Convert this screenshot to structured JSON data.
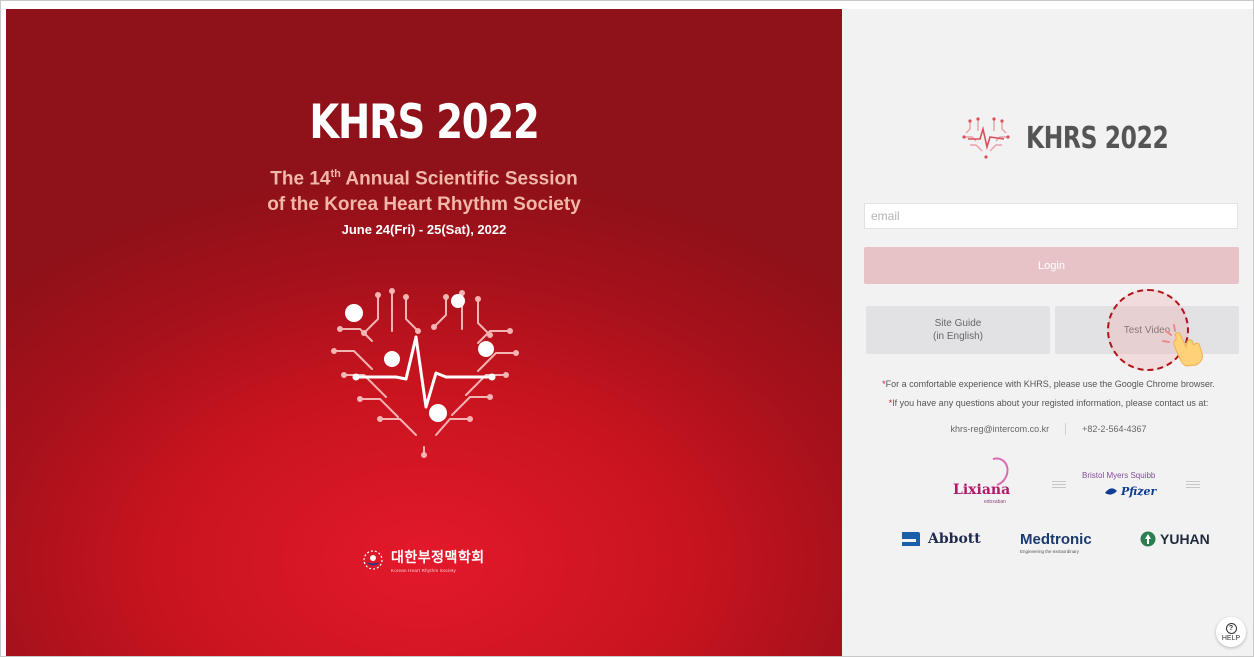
{
  "hero": {
    "title": "KHRS 2022",
    "subtitle_line1_pre": "The 14",
    "subtitle_line1_sup": "th",
    "subtitle_line1_post": " Annual Scientific Session",
    "subtitle_line2": "of the Korea Heart Rhythm Society",
    "date": "June 24(Fri) - 25(Sat), 2022",
    "society_korean": "대한부정맥학회",
    "society_english": "Korean Heart Rhythm Society"
  },
  "panel": {
    "brand": "KHRS 2022",
    "email_placeholder": "email",
    "email_value": "",
    "login_label": "Login",
    "site_guide_line1": "Site Guide",
    "site_guide_line2": "(in English)",
    "test_video_label": "Test Video",
    "note1": "For a comfortable experience with KHRS, please use the Google Chrome browser.",
    "note2": "If you have any questions about your registed information, please contact us at:",
    "note_star": "*",
    "contact_email": "khrs-reg@intercom.co.kr",
    "contact_phone": "+82-2-564-4367",
    "help_label": "HELP"
  },
  "sponsors": {
    "lixiana": "Lixiana",
    "lixiana_sub": "edoxaban",
    "bms": "Bristol Myers Squibb",
    "pfizer": "Pfizer",
    "abbott": "Abbott",
    "medtronic": "Medtronic",
    "medtronic_sub": "Engineering the extraordinary",
    "yuhan": "YUHAN"
  },
  "colors": {
    "hero_red": "#c8141f",
    "login_pink": "#e7c3c8",
    "annotation_red": "#b01419",
    "panel_bg": "#f2f2f3"
  }
}
